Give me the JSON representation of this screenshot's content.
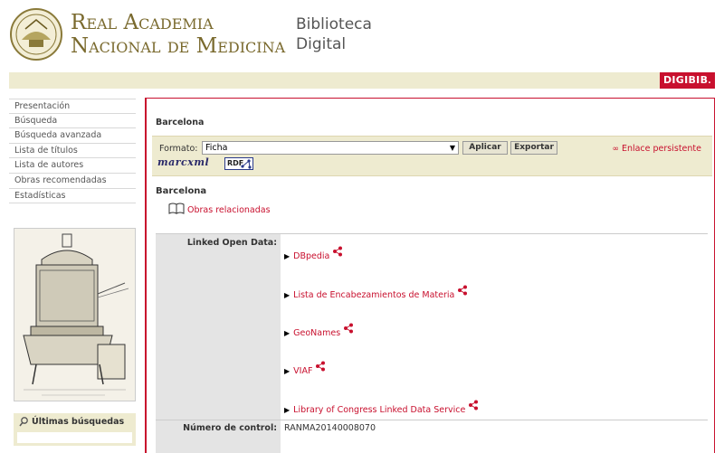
{
  "header": {
    "academy_line1": "Real Academia",
    "academy_line2": "Nacional de Medicina",
    "library_line1": "Biblioteca",
    "library_line2": "Digital",
    "brand": "DIGIBIB"
  },
  "nav": {
    "items": [
      {
        "label": "Presentación"
      },
      {
        "label": "Búsqueda"
      },
      {
        "label": "Búsqueda avanzada"
      },
      {
        "label": "Lista de títulos"
      },
      {
        "label": "Lista de autores"
      },
      {
        "label": "Obras recomendadas"
      },
      {
        "label": "Estadísticas"
      }
    ]
  },
  "last_searches": {
    "title": "Últimas búsquedas"
  },
  "main": {
    "title": "Barcelona",
    "format_label": "Formato:",
    "format_value": "Ficha",
    "apply_label": "Aplicar",
    "export_label": "Exportar",
    "permalink_label": "Enlace persistente",
    "marcxml_label": "marcxml",
    "rdf_label": "RDF",
    "record_title": "Barcelona",
    "related_label": "Obras relacionadas"
  },
  "details": {
    "lod_label": "Linked Open Data:",
    "lod_items": [
      {
        "label": "DBpedia"
      },
      {
        "label": "Lista de Encabezamientos de Materia"
      },
      {
        "label": "GeoNames"
      },
      {
        "label": "VIAF"
      },
      {
        "label": "Library of Congress Linked Data Service"
      }
    ],
    "control_label": "Número de control:",
    "control_value": "RANMA20140008070"
  },
  "colors": {
    "accent": "#c8102e",
    "band": "#eeebd0",
    "gold": "#7a6a2e"
  }
}
